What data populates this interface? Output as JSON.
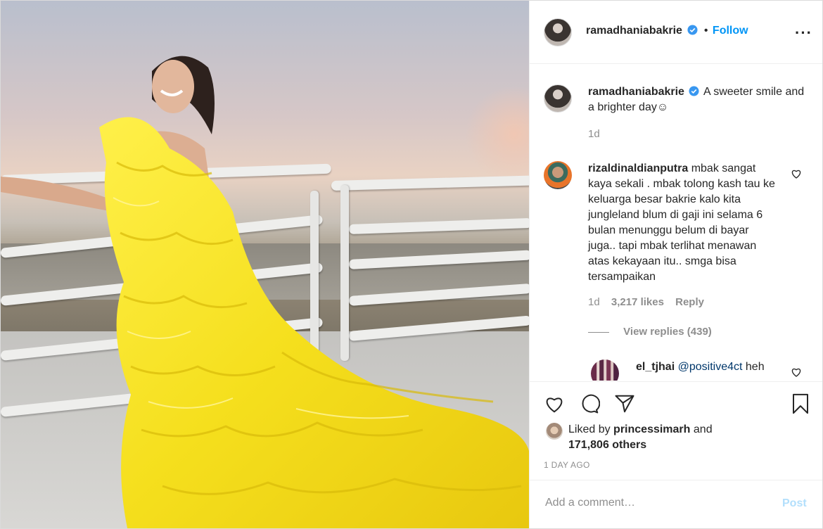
{
  "post": {
    "username": "ramadhaniabakrie",
    "verified": true,
    "follow_separator": "•",
    "follow_label": "Follow",
    "more_icon": "more-horizontal-icon",
    "caption_username": "ramadhaniabakrie",
    "caption_text": "A sweeter smile and a brighter day☺",
    "caption_time": "1d"
  },
  "comments": [
    {
      "username": "rizaldinaldianputra",
      "text": "mbak sangat kaya sekali . mbak tolong kash tau ke keluarga besar bakrie kalo kita jungleland blum di gaji ini selama 6 bulan menunggu belum di bayar juga.. tapi mbak terlihat menawan atas kekayaan itu.. smga bisa tersampaikan",
      "time": "1d",
      "likes": "3,217 likes",
      "reply": "Reply",
      "view_replies": "View replies (439)"
    },
    {
      "username": "el_tjhai",
      "mention": "@positive4ct",
      "text": "heh"
    }
  ],
  "actions": {
    "liked_prefix": "Liked by",
    "liked_user": "princessimarh",
    "liked_and": "and",
    "liked_others": "171,806 others",
    "date": "1 DAY AGO"
  },
  "add_comment": {
    "placeholder": "Add a comment…",
    "post_label": "Post"
  },
  "colors": {
    "link_blue": "#0095f6",
    "post_disabled": "#b2dffc",
    "dress_yellow": "#f5e21f"
  }
}
